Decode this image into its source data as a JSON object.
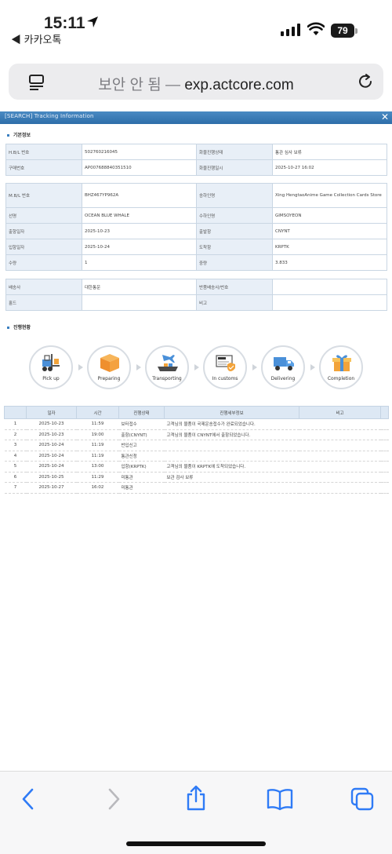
{
  "status": {
    "time": "15:11",
    "back_app": "◀ 카카오톡",
    "battery": "79"
  },
  "browser": {
    "insecure_label": "보안 안 됨",
    "separator": " — ",
    "domain": "exp.actcore.com"
  },
  "window": {
    "title": "[SEARCH]  Tracking Information",
    "close": "✕"
  },
  "sections": {
    "basic": "기본정보",
    "progress": "진행현황"
  },
  "basic_table_1": [
    {
      "l1": "H.B/L 번호",
      "v1": "502760216045",
      "l2": "화물진행상태",
      "v2": "통관 심사 보류"
    },
    {
      "l1": "구매번호",
      "v1": "AP007688840351510",
      "l2": "화물진행일시",
      "v2": "2025-10-27 16:02"
    }
  ],
  "basic_table_2": [
    {
      "l1": "M.B/L 번호",
      "v1": "BHZ467YP962A",
      "l2": "송하인명",
      "v2": "Xing HengtaoAnime Game Collection Cards Store"
    },
    {
      "l1": "선명",
      "v1": "OCEAN BLUE WHALE",
      "l2": "수하인명",
      "v2": "GIMSOYEON"
    },
    {
      "l1": "출항일자",
      "v1": "2025-10-23",
      "l2": "출발항",
      "v2": "CNYNT"
    },
    {
      "l1": "입항일자",
      "v1": "2025-10-24",
      "l2": "도착항",
      "v2": "KRPTK"
    },
    {
      "l1": "수량",
      "v1": "1",
      "l2": "중량",
      "v2": "3.833"
    }
  ],
  "basic_table_3": [
    {
      "l1": "배송사",
      "v1": "대한통운",
      "l2": "반품배송사/번호",
      "v2": ""
    },
    {
      "l1": "홀드",
      "v1": "",
      "l2": "비고",
      "v2": ""
    }
  ],
  "steps": [
    {
      "label": "Pick up",
      "icon": "forklift-icon"
    },
    {
      "label": "Preparing",
      "icon": "box-icon"
    },
    {
      "label": "Transporting",
      "icon": "ship-plane-icon"
    },
    {
      "label": "In customs",
      "icon": "customs-icon"
    },
    {
      "label": "Delivering",
      "icon": "truck-icon"
    },
    {
      "label": "Completion",
      "icon": "gift-icon"
    }
  ],
  "history": {
    "headers": [
      "",
      "일자",
      "시간",
      "진행상태",
      "진행세부정보",
      "비고"
    ],
    "rows": [
      {
        "no": "1",
        "date": "2025-10-23",
        "time": "11:59",
        "state": "보터접수",
        "detail": "고객님의 물품이 국제운송접수가 완료되었습니다.",
        "note": ""
      },
      {
        "no": "2",
        "date": "2025-10-23",
        "time": "19:00",
        "state": "출항(CNYNT)",
        "detail": "고객님의 물품이 CNYNT에서 출항되었습니다.",
        "note": ""
      },
      {
        "no": "3",
        "date": "2025-10-24",
        "time": "11:19",
        "state": "반입신고",
        "detail": "",
        "note": ""
      },
      {
        "no": "4",
        "date": "2025-10-24",
        "time": "11:19",
        "state": "통관신청",
        "detail": "",
        "note": ""
      },
      {
        "no": "5",
        "date": "2025-10-24",
        "time": "13:00",
        "state": "입항(KRPTK)",
        "detail": "고객님의 물품이 KRPTK에 도착되었습니다.",
        "note": ""
      },
      {
        "no": "6",
        "date": "2025-10-25",
        "time": "11:29",
        "state": "미통관",
        "detail": "보관 검사 보류",
        "note": ""
      },
      {
        "no": "7",
        "date": "2025-10-27",
        "time": "16:02",
        "state": "미통관",
        "detail": "",
        "note": ""
      }
    ]
  },
  "colors": {
    "accent": "#2f6fa8",
    "ios_blue": "#2f7bf6"
  }
}
